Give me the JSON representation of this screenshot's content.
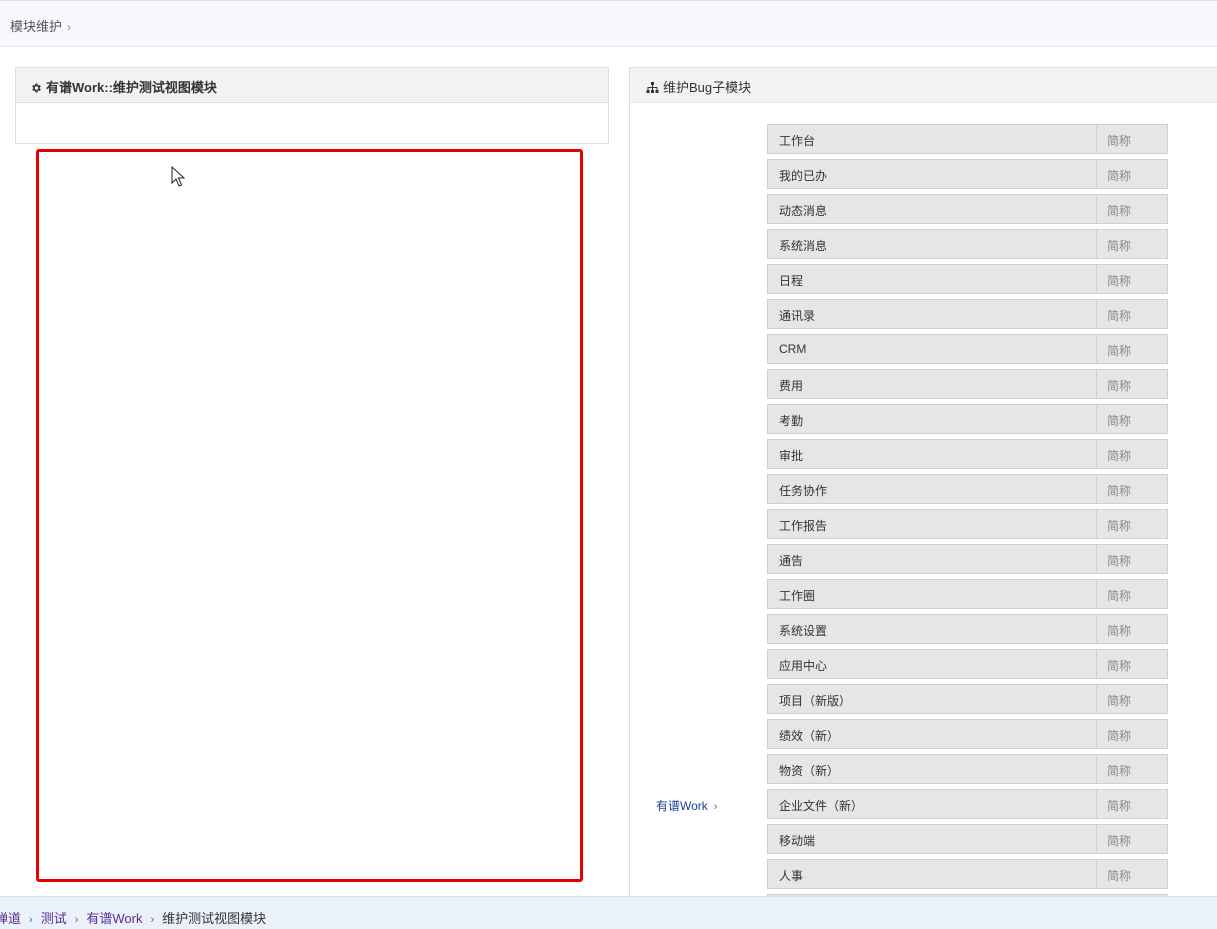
{
  "top_breadcrumb": {
    "label": "模块维护",
    "chevron": "›"
  },
  "left_panel": {
    "title": "有谱Work::维护测试视图模块",
    "icon": "gear-icon"
  },
  "right_panel": {
    "title": "维护Bug子模块",
    "icon": "sitemap-icon",
    "parent_link": "有谱Work",
    "short_placeholder": "简称",
    "modules": [
      "工作台",
      "我的已办",
      "动态消息",
      "系统消息",
      "日程",
      "通讯录",
      "CRM",
      "费用",
      "考勤",
      "审批",
      "任务协作",
      "工作报告",
      "通告",
      "工作圈",
      "系统设置",
      "应用中心",
      "项目（新版）",
      "绩效（新）",
      "物资（新）",
      "企业文件（新）",
      "移动端",
      "人事"
    ]
  },
  "bottom_breadcrumb": {
    "items": [
      "禅道",
      "测试",
      "有谱Work",
      "维护测试视图模块"
    ],
    "separator": "›"
  },
  "colors": {
    "highlight_frame": "#e60000",
    "link": "#1a3f9b",
    "visited_link": "#5b2e91"
  }
}
